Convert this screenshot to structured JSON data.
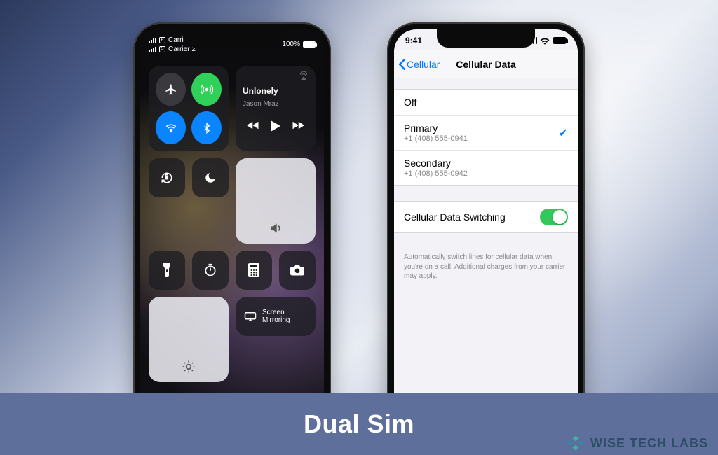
{
  "caption": "Dual Sim",
  "brand": "WISE TECH LABS",
  "left_phone": {
    "status": {
      "line1_sim": "P",
      "line1_text": "Carrier LTE",
      "line2_sim": "S",
      "line2_text": "Carrier 2",
      "battery_pct": "100%"
    },
    "music": {
      "title": "Unlonely",
      "artist": "Jason Mraz"
    },
    "mirroring_label": "Screen\nMirroring"
  },
  "right_phone": {
    "status_time": "9:41",
    "nav_back": "Cellular",
    "nav_title": "Cellular Data",
    "rows": {
      "off": "Off",
      "primary_label": "Primary",
      "primary_number": "+1 (408) 555-0941",
      "secondary_label": "Secondary",
      "secondary_number": "+1 (408) 555-0942",
      "switching_label": "Cellular Data Switching"
    },
    "footer": "Automatically switch lines for cellular data when you're on a call. Additional charges from your carrier may apply."
  }
}
